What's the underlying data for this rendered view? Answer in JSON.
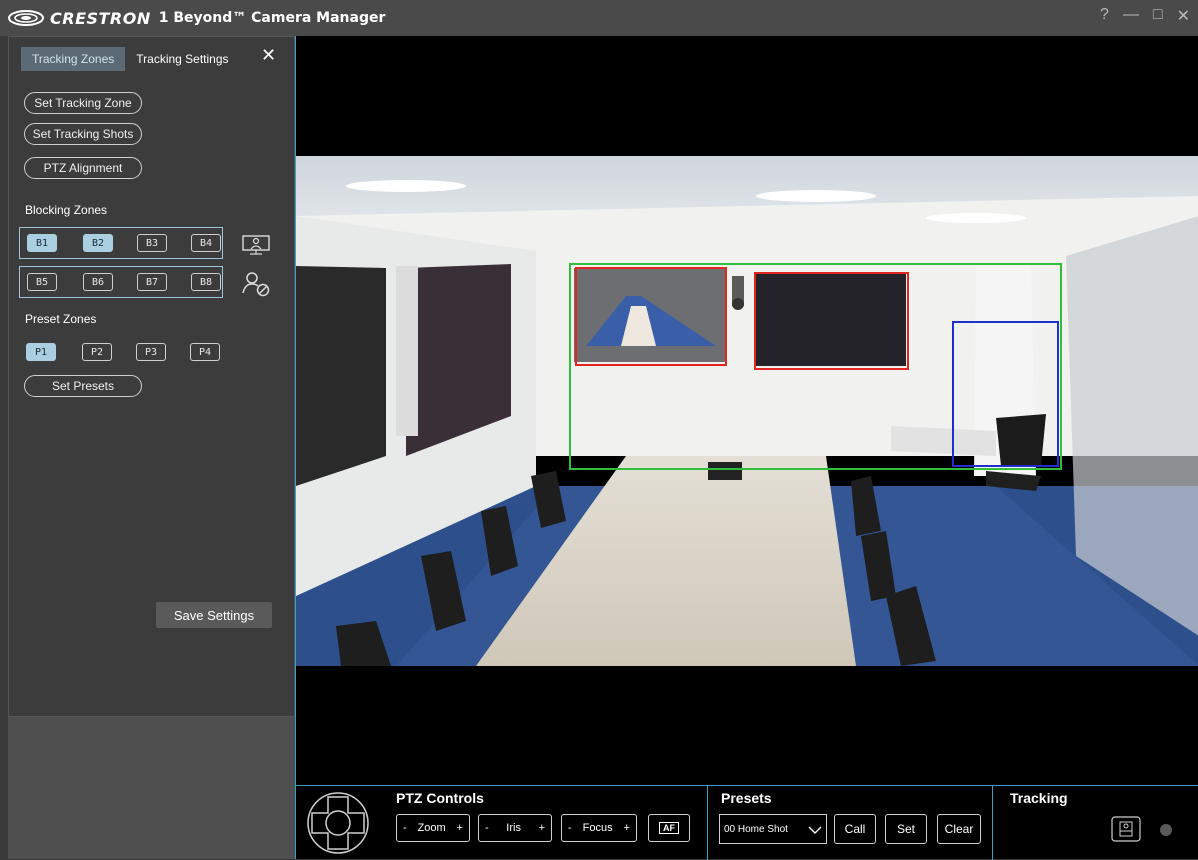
{
  "titlebar": {
    "brand": "CRESTRON",
    "title": "1 Beyond™ Camera Manager",
    "help": "?",
    "minimize": "—",
    "maximize": "□",
    "close": "✕"
  },
  "panel": {
    "tabs": [
      {
        "label": "Tracking Zones",
        "active": true
      },
      {
        "label": "Tracking Settings",
        "active": false
      }
    ],
    "close_label": "✕",
    "set_tracking_zone": "Set Tracking Zone",
    "set_tracking_shots": "Set Tracking Shots",
    "ptz_alignment": "PTZ Alignment",
    "blocking_zones_title": "Blocking Zones",
    "blocking_row1": [
      {
        "label": "B1",
        "on": true
      },
      {
        "label": "B2",
        "on": true
      },
      {
        "label": "B3",
        "on": false
      },
      {
        "label": "B4",
        "on": false
      }
    ],
    "blocking_row2": [
      {
        "label": "B5",
        "on": false
      },
      {
        "label": "B6",
        "on": false
      },
      {
        "label": "B7",
        "on": false
      },
      {
        "label": "B8",
        "on": false
      }
    ],
    "preset_zones_title": "Preset Zones",
    "preset_zones": [
      {
        "label": "P1",
        "on": true
      },
      {
        "label": "P2",
        "on": false
      },
      {
        "label": "P3",
        "on": false
      },
      {
        "label": "P4",
        "on": false
      }
    ],
    "set_presets": "Set Presets",
    "save_settings": "Save Settings"
  },
  "controls": {
    "ptz_title": "PTZ Controls",
    "zoom_label": "Zoom",
    "iris_label": "Iris",
    "focus_label": "Focus",
    "minus": "-",
    "plus": "+",
    "af_label": "AF",
    "presets_title": "Presets",
    "preset_selected": "00 Home Shot",
    "call_label": "Call",
    "set_label": "Set",
    "clear_label": "Clear",
    "tracking_title": "Tracking"
  },
  "colors": {
    "accent": "#3aa0c8",
    "zone_on": "#a9cfe0",
    "tracking_zone": "#2fbf3a",
    "blocking_zone": "#e0261f",
    "preset_zone": "#1f2fcf"
  }
}
